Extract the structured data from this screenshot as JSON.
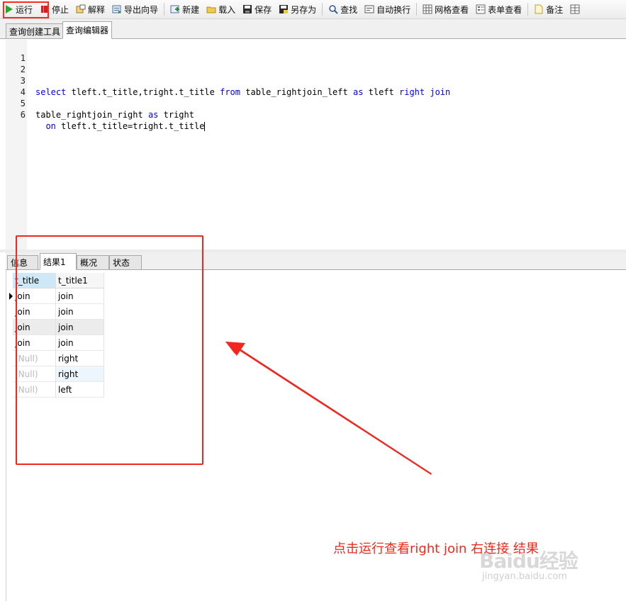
{
  "toolbar": {
    "run": "运行",
    "stop": "停止",
    "explain": "解释",
    "export_wizard": "导出向导",
    "new": "新建",
    "load": "载入",
    "save": "保存",
    "save_as": "另存为",
    "find": "查找",
    "word_wrap": "自动换行",
    "grid_view": "网格查看",
    "form_view": "表单查看",
    "notes": "备注"
  },
  "top_tabs": [
    "查询创建工具",
    "查询编辑器"
  ],
  "editor": {
    "line_numbers": [
      "1",
      "2",
      "3",
      "4",
      "5",
      "6"
    ],
    "line3": {
      "t1": "select",
      "t2": " tleft.t_title,tright.t_title ",
      "t3": "from",
      "t4": " table_rightjoin_left ",
      "t5": "as",
      "t6": " tleft ",
      "t7": "right",
      "t8": " ",
      "t9": "join"
    },
    "line5": {
      "t1": "table_rightjoin_right ",
      "t2": "as",
      "t3": " tright"
    },
    "line6": {
      "t1": "  ",
      "t2": "on",
      "t3": " tleft.t_title=tright.t_title"
    }
  },
  "bottom_tabs": [
    "信息",
    "结果1",
    "概况",
    "状态"
  ],
  "results": {
    "columns": [
      "t_title",
      "t_title1"
    ],
    "rows": [
      [
        "join",
        "join"
      ],
      [
        "join",
        "join"
      ],
      [
        "join",
        "join"
      ],
      [
        "join",
        "join"
      ],
      [
        "(Null)",
        "right"
      ],
      [
        "(Null)",
        "right"
      ],
      [
        "(Null)",
        "left"
      ]
    ]
  },
  "annotation": "点击运行查看right  join 右连接 结果",
  "watermark": {
    "main": "Baidu经验",
    "sub": "jingyan.baidu.com"
  },
  "colors": {
    "annotation_red": "#f02a1a",
    "keyword_blue": "#0000ee",
    "header_highlight": "#cfe8f7"
  }
}
